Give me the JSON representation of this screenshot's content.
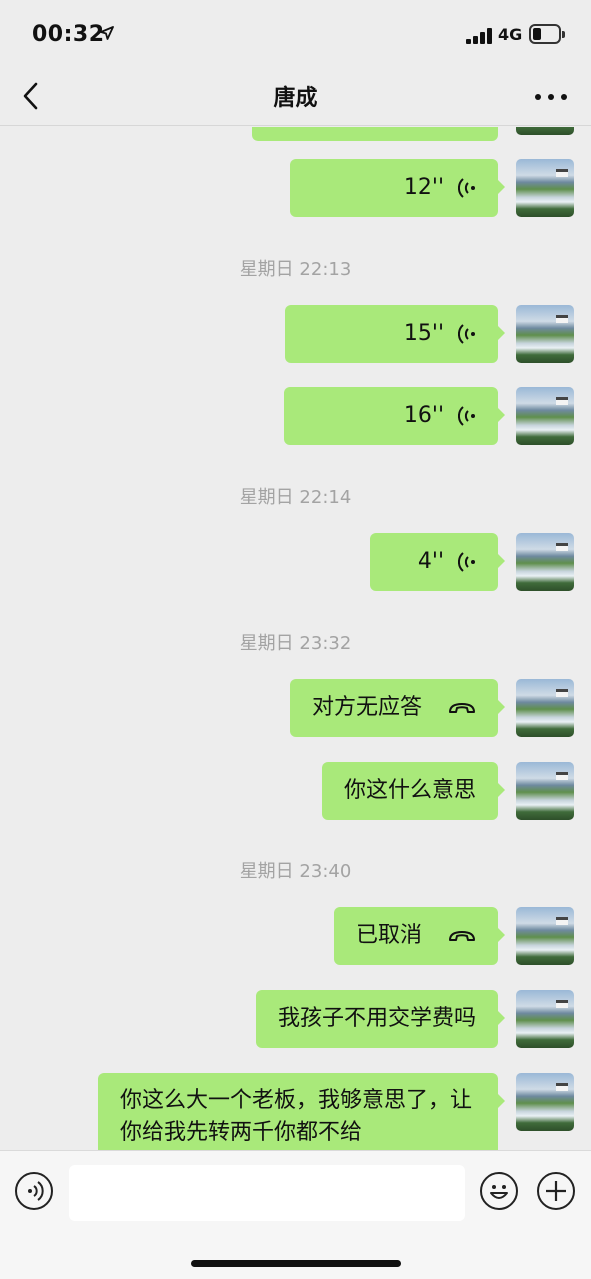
{
  "status_bar": {
    "time": "00:32",
    "network": "4G",
    "icons": [
      "location-arrow-icon",
      "signal-bars-icon",
      "battery-icon"
    ]
  },
  "nav": {
    "title": "唐成",
    "back_icon": "chevron-left-icon",
    "more_icon": "more-dots-icon"
  },
  "messages": [
    {
      "type": "voice",
      "duration": "",
      "partial": true
    },
    {
      "type": "voice",
      "duration": "12''"
    },
    {
      "type": "time",
      "text": "星期日 22:13"
    },
    {
      "type": "voice",
      "duration": "15''"
    },
    {
      "type": "voice",
      "duration": "16''"
    },
    {
      "type": "time",
      "text": "星期日 22:14"
    },
    {
      "type": "voice",
      "duration": "4''"
    },
    {
      "type": "time",
      "text": "星期日 23:32"
    },
    {
      "type": "call",
      "text": "对方无应答"
    },
    {
      "type": "text",
      "text": "你这什么意思"
    },
    {
      "type": "time",
      "text": "星期日 23:40"
    },
    {
      "type": "call",
      "text": "已取消"
    },
    {
      "type": "text",
      "text": "我孩子不用交学费吗"
    },
    {
      "type": "text",
      "text": "你这么大一个老板，我够意思了，让你给我先转两千你都不给"
    }
  ],
  "colors": {
    "bubble": "#a9e97a",
    "background": "#ededed",
    "time_label": "#a3a3a3",
    "input_bar": "#f6f6f6"
  },
  "input_bar": {
    "placeholder": "",
    "icons": [
      "voice-input-icon",
      "emoji-icon",
      "plus-icon"
    ]
  }
}
